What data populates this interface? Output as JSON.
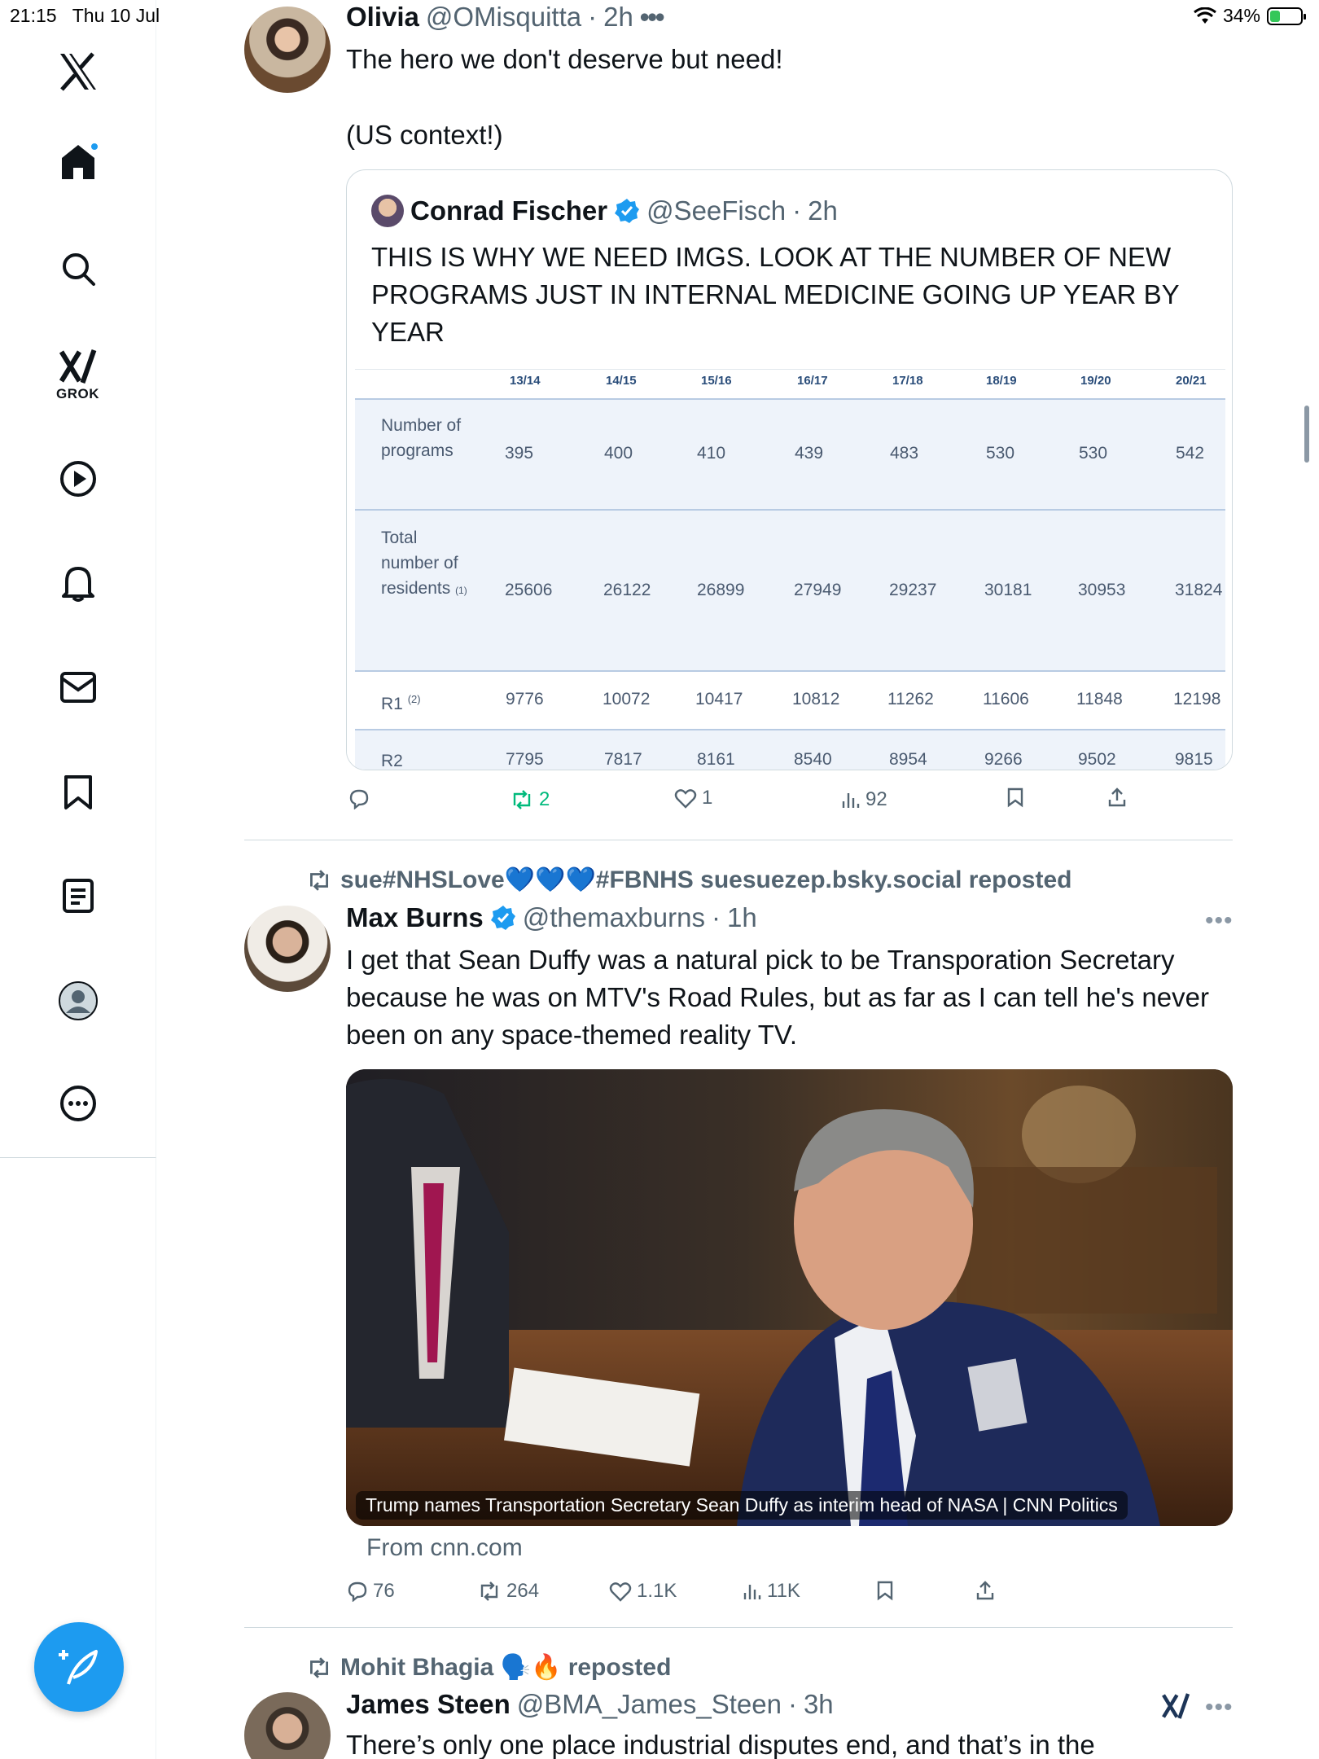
{
  "status_bar": {
    "time": "21:15",
    "date": "Thu 10 Jul",
    "battery": "34%",
    "battery_level": 0.34
  },
  "sidebar": {
    "items": [
      {
        "name": "x-logo-icon"
      },
      {
        "name": "home-icon"
      },
      {
        "name": "search-icon"
      },
      {
        "name": "grok-icon",
        "label": "GROK"
      },
      {
        "name": "video-play-icon"
      },
      {
        "name": "bell-icon"
      },
      {
        "name": "mail-icon"
      },
      {
        "name": "bookmark-icon"
      },
      {
        "name": "list-icon"
      },
      {
        "name": "profile-icon"
      },
      {
        "name": "more-icon"
      }
    ]
  },
  "tweets": [
    {
      "name": "Olivia",
      "handle": "@OMisquitta",
      "time": "2h",
      "text1": "The hero we don't deserve but need!",
      "text2": "(US context!)",
      "quote": {
        "name": "Conrad Fischer",
        "handle": "@SeeFisch",
        "time": "2h",
        "text": "THIS IS WHY WE NEED IMGS. LOOK AT THE NUMBER OF NEW PROGRAMS JUST IN INTERNAL MEDICINE GOING UP YEAR BY YEAR",
        "table": {
          "columns": [
            "13/14",
            "14/15",
            "15/16",
            "16/17",
            "17/18",
            "18/19",
            "19/20",
            "20/21"
          ],
          "rows": [
            {
              "label": "Number of programs",
              "values": [
                "395",
                "400",
                "410",
                "439",
                "483",
                "530",
                "530",
                "542"
              ]
            },
            {
              "label": "Total number of residents",
              "note": "(1)",
              "values": [
                "25606",
                "26122",
                "26899",
                "27949",
                "29237",
                "30181",
                "30953",
                "31824"
              ]
            },
            {
              "label": "R1",
              "note": "(2)",
              "values": [
                "9776",
                "10072",
                "10417",
                "10812",
                "11262",
                "11606",
                "11848",
                "12198"
              ]
            },
            {
              "label": "R2",
              "values": [
                "7795",
                "7817",
                "8161",
                "8540",
                "8954",
                "9266",
                "9502",
                "9815"
              ]
            }
          ]
        }
      },
      "stats": {
        "replies": "",
        "reposts": "2",
        "likes": "1",
        "views": "92"
      }
    },
    {
      "reposted_by": "sue#NHSLove💙💙💙#FBNHS suesuezep.bsky.social reposted",
      "name": "Max Burns",
      "handle": "@themaxburns",
      "time": "1h",
      "text": "I get that Sean Duffy was a natural pick to be Transporation Secretary because he was on MTV's Road Rules, but as far as I can tell he's never been on any space-themed reality TV.",
      "media_caption": "Trump names Transportation Secretary Sean Duffy as interim head of NASA | CNN Politics",
      "from": "From cnn.com",
      "stats": {
        "replies": "76",
        "reposts": "264",
        "likes": "1.1K",
        "views": "11K"
      }
    },
    {
      "reposted_by": "Mohit Bhagia 🗣️🔥 reposted",
      "name": "James Steen",
      "handle": "@BMA_James_Steen",
      "time": "3h",
      "text": "There’s only one place industrial disputes end, and that’s in the"
    }
  ],
  "colors": {
    "accent": "#1d9bf0",
    "repost_green": "#00ba7c",
    "muted": "#536471"
  }
}
